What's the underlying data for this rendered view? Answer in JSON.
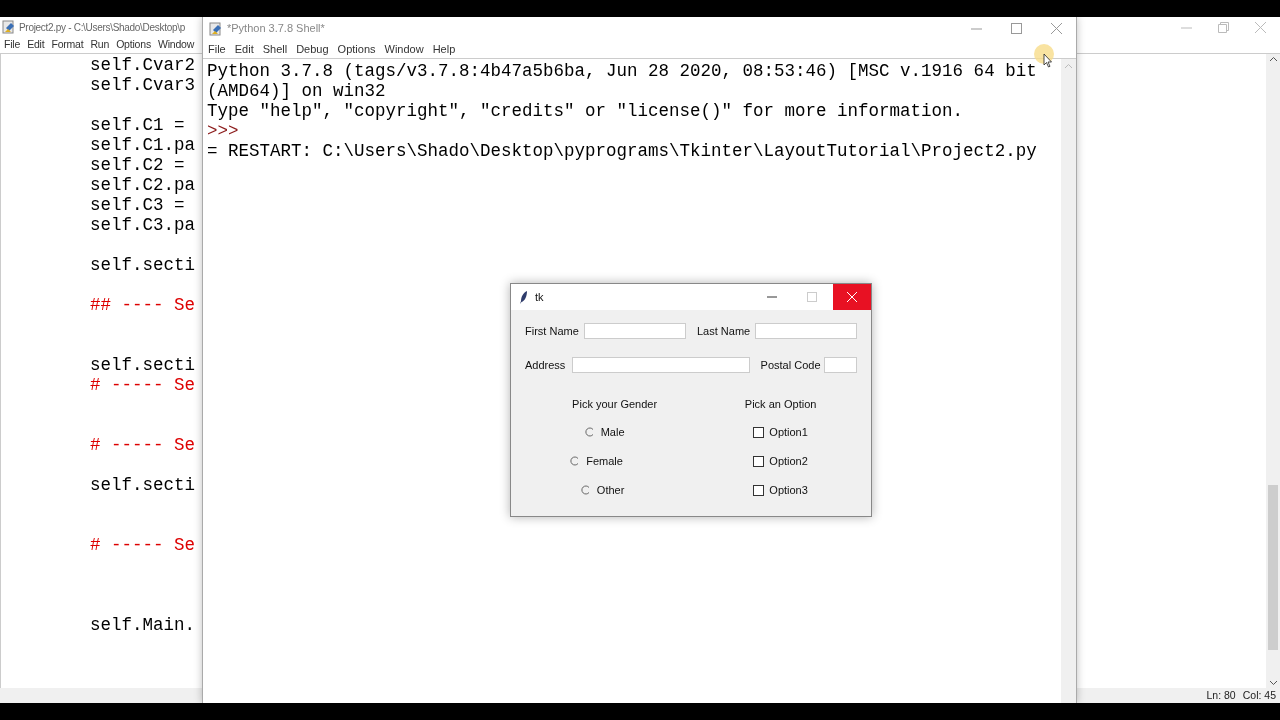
{
  "editor_window": {
    "title": "Project2.py - C:\\Users\\Shado\\Desktop\\p",
    "menu": [
      "File",
      "Edit",
      "Format",
      "Run",
      "Options",
      "Window"
    ],
    "lines": [
      {
        "kind": "code",
        "text": "self.Cvar2"
      },
      {
        "kind": "code",
        "text": "self.Cvar3"
      },
      {
        "kind": "blank"
      },
      {
        "kind": "code",
        "text": "self.C1 ="
      },
      {
        "kind": "code",
        "text": "self.C1.pa"
      },
      {
        "kind": "code",
        "text": "self.C2 ="
      },
      {
        "kind": "code",
        "text": "self.C2.pa"
      },
      {
        "kind": "code",
        "text": "self.C3 ="
      },
      {
        "kind": "code",
        "text": "self.C3.pa"
      },
      {
        "kind": "blank"
      },
      {
        "kind": "code",
        "text": "self.secti"
      },
      {
        "kind": "blank"
      },
      {
        "kind": "comment",
        "text": "## ---- Se"
      },
      {
        "kind": "blank"
      },
      {
        "kind": "blank"
      },
      {
        "kind": "code",
        "text": "self.secti"
      },
      {
        "kind": "comment",
        "text": "# ----- Se"
      },
      {
        "kind": "blank"
      },
      {
        "kind": "blank"
      },
      {
        "kind": "comment",
        "text": "# ----- Se"
      },
      {
        "kind": "blank"
      },
      {
        "kind": "code",
        "text": "self.secti"
      },
      {
        "kind": "blank"
      },
      {
        "kind": "blank"
      },
      {
        "kind": "comment",
        "text": "# ----- Se"
      },
      {
        "kind": "blank"
      },
      {
        "kind": "blank"
      },
      {
        "kind": "blank"
      },
      {
        "kind": "code",
        "text": "self.Main."
      }
    ],
    "status_bar": [
      "Ln: 80",
      "Col: 45"
    ]
  },
  "shell_window": {
    "title": "*Python 3.7.8 Shell*",
    "menu": [
      "File",
      "Edit",
      "Shell",
      "Debug",
      "Options",
      "Window",
      "Help"
    ],
    "lines": [
      {
        "kind": "output",
        "text": "Python 3.7.8 (tags/v3.7.8:4b47a5b6ba, Jun 28 2020, 08:53:46) [MSC v.1916 64 bit"
      },
      {
        "kind": "output",
        "text": "(AMD64)] on win32"
      },
      {
        "kind": "output",
        "text": "Type \"help\", \"copyright\", \"credits\" or \"license()\" for more information."
      },
      {
        "kind": "prompt",
        "text": ">>>"
      },
      {
        "kind": "output",
        "text": "= RESTART: C:\\Users\\Shado\\Desktop\\pyprograms\\Tkinter\\LayoutTutorial\\Project2.py"
      }
    ]
  },
  "tk_window": {
    "title": "tk",
    "fields": [
      {
        "label": "First Name"
      },
      {
        "label": "Last Name"
      },
      {
        "label": "Address"
      },
      {
        "label": "Postal Code"
      }
    ],
    "gender": {
      "heading": "Pick your Gender",
      "options": [
        {
          "label": "Male",
          "selected": false
        },
        {
          "label": "Female",
          "selected": false
        },
        {
          "label": "Other",
          "selected": false
        }
      ]
    },
    "options": {
      "heading": "Pick an Option",
      "items": [
        {
          "label": "Option1",
          "checked": false
        },
        {
          "label": "Option2",
          "checked": false
        },
        {
          "label": "Option3",
          "checked": false
        }
      ]
    }
  }
}
